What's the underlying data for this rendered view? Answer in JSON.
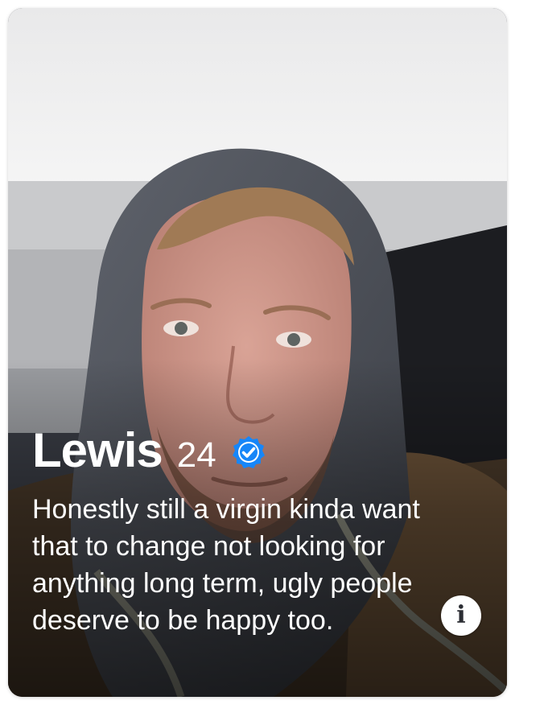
{
  "profile": {
    "name": "Lewis",
    "age": "24",
    "verified": true,
    "bio": "Honestly still a virgin kinda want that to change not looking for anything long term, ugly people deserve to be happy too."
  },
  "icons": {
    "verified": "verified-badge-icon",
    "info": "info-icon",
    "info_glyph": "i"
  },
  "colors": {
    "verified_blue": "#1786F8",
    "text": "#FFFFFF"
  }
}
